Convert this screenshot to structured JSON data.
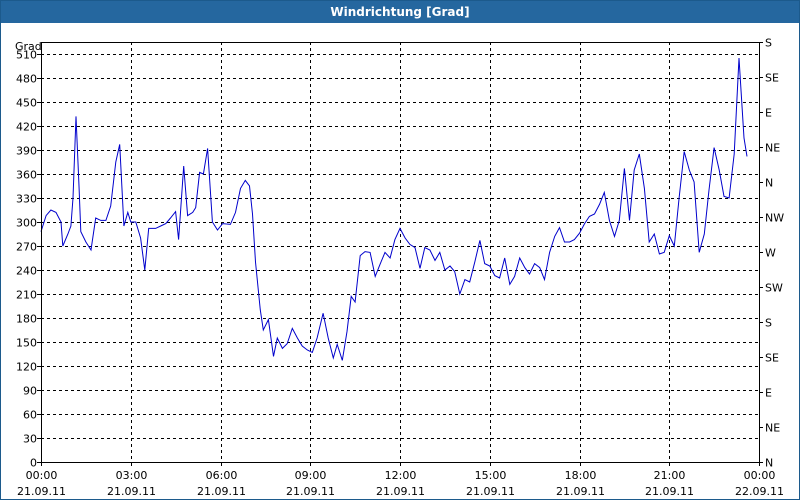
{
  "window": {
    "title": "Windrichtung [Grad]"
  },
  "chart_data": {
    "type": "line",
    "title": "Windrichtung [Grad]",
    "ylabel": "Grad",
    "xlabel": "",
    "ylim": [
      0,
      525
    ],
    "yticks": [
      0,
      30,
      60,
      90,
      120,
      150,
      180,
      210,
      240,
      270,
      300,
      330,
      360,
      390,
      420,
      450,
      480,
      510
    ],
    "y2_ticks": [
      {
        "value": 0,
        "label": "N"
      },
      {
        "value": 45,
        "label": "NE"
      },
      {
        "value": 90,
        "label": "E"
      },
      {
        "value": 135,
        "label": "SE"
      },
      {
        "value": 180,
        "label": "S"
      },
      {
        "value": 225,
        "label": "SW"
      },
      {
        "value": 270,
        "label": "W"
      },
      {
        "value": 315,
        "label": "NW"
      },
      {
        "value": 360,
        "label": "N"
      },
      {
        "value": 405,
        "label": "NE"
      },
      {
        "value": 450,
        "label": "E"
      },
      {
        "value": 495,
        "label": "SE"
      },
      {
        "value": 540,
        "label": "S"
      }
    ],
    "xticks": [
      {
        "time": "00:00",
        "date": "21.09.11"
      },
      {
        "time": "03:00",
        "date": "21.09.11"
      },
      {
        "time": "06:00",
        "date": "21.09.11"
      },
      {
        "time": "09:00",
        "date": "21.09.11"
      },
      {
        "time": "12:00",
        "date": "21.09.11"
      },
      {
        "time": "15:00",
        "date": "21.09.11"
      },
      {
        "time": "18:00",
        "date": "21.09.11"
      },
      {
        "time": "21:00",
        "date": "21.09.11"
      },
      {
        "time": "00:00",
        "date": "22.09.11"
      }
    ],
    "x_range_hours": [
      0,
      24
    ],
    "grid": true,
    "series": [
      {
        "color": "#0000cc",
        "points": [
          [
            0.0,
            288
          ],
          [
            0.17,
            308
          ],
          [
            0.33,
            315
          ],
          [
            0.5,
            312
          ],
          [
            0.67,
            300
          ],
          [
            0.73,
            270
          ],
          [
            0.9,
            285
          ],
          [
            1.0,
            295
          ],
          [
            1.07,
            330
          ],
          [
            1.17,
            432
          ],
          [
            1.27,
            345
          ],
          [
            1.33,
            288
          ],
          [
            1.5,
            275
          ],
          [
            1.67,
            265
          ],
          [
            1.83,
            305
          ],
          [
            2.0,
            302
          ],
          [
            2.17,
            302
          ],
          [
            2.33,
            320
          ],
          [
            2.5,
            375
          ],
          [
            2.63,
            397
          ],
          [
            2.77,
            295
          ],
          [
            2.9,
            312
          ],
          [
            3.0,
            300
          ],
          [
            3.17,
            300
          ],
          [
            3.33,
            280
          ],
          [
            3.47,
            240
          ],
          [
            3.6,
            292
          ],
          [
            3.83,
            292
          ],
          [
            4.0,
            295
          ],
          [
            4.17,
            298
          ],
          [
            4.33,
            305
          ],
          [
            4.5,
            313
          ],
          [
            4.6,
            278
          ],
          [
            4.77,
            370
          ],
          [
            4.9,
            308
          ],
          [
            5.07,
            312
          ],
          [
            5.17,
            318
          ],
          [
            5.3,
            362
          ],
          [
            5.43,
            360
          ],
          [
            5.57,
            392
          ],
          [
            5.73,
            300
          ],
          [
            5.9,
            290
          ],
          [
            6.07,
            298
          ],
          [
            6.33,
            297
          ],
          [
            6.5,
            312
          ],
          [
            6.67,
            342
          ],
          [
            6.83,
            352
          ],
          [
            6.97,
            345
          ],
          [
            7.07,
            310
          ],
          [
            7.17,
            250
          ],
          [
            7.33,
            190
          ],
          [
            7.43,
            165
          ],
          [
            7.6,
            178
          ],
          [
            7.77,
            132
          ],
          [
            7.9,
            155
          ],
          [
            8.07,
            142
          ],
          [
            8.23,
            148
          ],
          [
            8.4,
            167
          ],
          [
            8.57,
            155
          ],
          [
            8.73,
            145
          ],
          [
            8.9,
            140
          ],
          [
            9.07,
            137
          ],
          [
            9.23,
            155
          ],
          [
            9.43,
            186
          ],
          [
            9.6,
            155
          ],
          [
            9.77,
            130
          ],
          [
            9.9,
            147
          ],
          [
            10.07,
            127
          ],
          [
            10.23,
            163
          ],
          [
            10.37,
            207
          ],
          [
            10.5,
            200
          ],
          [
            10.67,
            258
          ],
          [
            10.83,
            263
          ],
          [
            11.0,
            262
          ],
          [
            11.17,
            232
          ],
          [
            11.33,
            247
          ],
          [
            11.5,
            262
          ],
          [
            11.67,
            255
          ],
          [
            11.83,
            278
          ],
          [
            12.0,
            292
          ],
          [
            12.17,
            280
          ],
          [
            12.33,
            272
          ],
          [
            12.5,
            268
          ],
          [
            12.67,
            242
          ],
          [
            12.83,
            268
          ],
          [
            13.0,
            265
          ],
          [
            13.17,
            252
          ],
          [
            13.33,
            262
          ],
          [
            13.5,
            240
          ],
          [
            13.67,
            245
          ],
          [
            13.83,
            238
          ],
          [
            14.0,
            210
          ],
          [
            14.17,
            228
          ],
          [
            14.33,
            225
          ],
          [
            14.5,
            250
          ],
          [
            14.67,
            277
          ],
          [
            14.83,
            248
          ],
          [
            15.0,
            245
          ],
          [
            15.17,
            233
          ],
          [
            15.33,
            230
          ],
          [
            15.5,
            255
          ],
          [
            15.67,
            222
          ],
          [
            15.83,
            232
          ],
          [
            16.0,
            255
          ],
          [
            16.17,
            243
          ],
          [
            16.33,
            235
          ],
          [
            16.5,
            248
          ],
          [
            16.67,
            243
          ],
          [
            16.83,
            228
          ],
          [
            17.0,
            262
          ],
          [
            17.17,
            282
          ],
          [
            17.33,
            293
          ],
          [
            17.5,
            275
          ],
          [
            17.67,
            275
          ],
          [
            17.83,
            278
          ],
          [
            18.0,
            286
          ],
          [
            18.17,
            298
          ],
          [
            18.33,
            307
          ],
          [
            18.5,
            310
          ],
          [
            18.67,
            322
          ],
          [
            18.83,
            337
          ],
          [
            19.0,
            302
          ],
          [
            19.17,
            282
          ],
          [
            19.33,
            302
          ],
          [
            19.5,
            367
          ],
          [
            19.67,
            302
          ],
          [
            19.83,
            365
          ],
          [
            20.0,
            385
          ],
          [
            20.17,
            342
          ],
          [
            20.33,
            275
          ],
          [
            20.5,
            285
          ],
          [
            20.67,
            260
          ],
          [
            20.83,
            262
          ],
          [
            21.0,
            283
          ],
          [
            21.17,
            270
          ],
          [
            21.33,
            330
          ],
          [
            21.5,
            388
          ],
          [
            21.67,
            365
          ],
          [
            21.83,
            350
          ],
          [
            22.0,
            262
          ],
          [
            22.17,
            285
          ],
          [
            22.33,
            340
          ],
          [
            22.5,
            393
          ],
          [
            22.67,
            365
          ],
          [
            22.83,
            332
          ],
          [
            23.0,
            330
          ],
          [
            23.17,
            385
          ],
          [
            23.33,
            505
          ],
          [
            23.5,
            405
          ],
          [
            23.6,
            382
          ]
        ]
      }
    ]
  }
}
